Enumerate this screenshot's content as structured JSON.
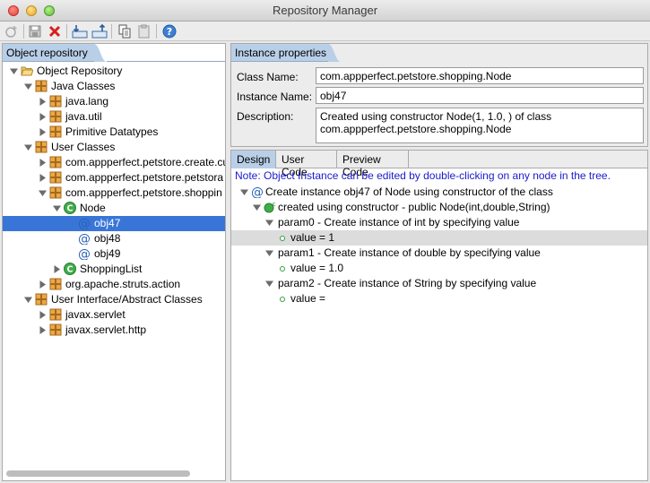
{
  "window": {
    "title": "Repository Manager"
  },
  "toolbar": {
    "icons": [
      "add-icon",
      "save-icon",
      "delete-icon",
      "import-icon",
      "export-icon",
      "copy-icon",
      "paste-icon",
      "help-icon"
    ]
  },
  "left": {
    "tab_label": "Object repository",
    "tree": [
      {
        "label": "Object Repository",
        "icon": "folder-open-icon",
        "expanded": true
      },
      {
        "label": "Java Classes",
        "icon": "package-icon",
        "expanded": true
      },
      {
        "label": "java.lang",
        "icon": "package-icon",
        "expanded": false
      },
      {
        "label": "java.util",
        "icon": "package-icon",
        "expanded": false
      },
      {
        "label": "Primitive Datatypes",
        "icon": "package-icon",
        "expanded": false
      },
      {
        "label": "User Classes",
        "icon": "package-icon",
        "expanded": true
      },
      {
        "label": "com.appperfect.petstore.create.cu",
        "icon": "package-icon",
        "expanded": false
      },
      {
        "label": "com.appperfect.petstore.petstora",
        "icon": "package-icon",
        "expanded": false
      },
      {
        "label": "com.appperfect.petstore.shoppin",
        "icon": "package-icon",
        "expanded": true
      },
      {
        "label": "Node",
        "icon": "class-icon",
        "expanded": true
      },
      {
        "label": "obj47",
        "icon": "instance-icon",
        "selected": true
      },
      {
        "label": "obj48",
        "icon": "instance-icon"
      },
      {
        "label": "obj49",
        "icon": "instance-icon"
      },
      {
        "label": "ShoppingList",
        "icon": "class-icon",
        "expanded": false
      },
      {
        "label": "org.apache.struts.action",
        "icon": "package-icon",
        "expanded": false
      },
      {
        "label": "User Interface/Abstract Classes",
        "icon": "package-icon",
        "expanded": true
      },
      {
        "label": "javax.servlet",
        "icon": "package-icon",
        "expanded": false
      },
      {
        "label": "javax.servlet.http",
        "icon": "package-icon",
        "expanded": false
      }
    ]
  },
  "instance": {
    "tab_label": "Instance properties",
    "class_name_label": "Class Name:",
    "class_name_value": "com.appperfect.petstore.shopping.Node",
    "instance_name_label": "Instance Name:",
    "instance_name_value": "obj47",
    "description_label": "Description:",
    "description_line1": "Created using  constructor Node(1, 1.0, ) of class",
    "description_line2": "com.appperfect.petstore.shopping.Node"
  },
  "design": {
    "tabs": [
      "Design",
      "User Code",
      "Preview Code"
    ],
    "note": "Note: Object Instance can be edited by double-clicking on any node in the tree.",
    "rows": [
      {
        "label": "Create instance obj47 of Node using constructor of the class",
        "kind": "instance"
      },
      {
        "label": "created using constructor - public Node(int,double,String)",
        "kind": "constructor"
      },
      {
        "label": "param0 - Create instance of int by specifying value",
        "kind": "param"
      },
      {
        "label": "value = 1",
        "kind": "value",
        "highlight": true
      },
      {
        "label": "param1 - Create instance of double by specifying value",
        "kind": "param"
      },
      {
        "label": "value = 1.0",
        "kind": "value"
      },
      {
        "label": "param2 - Create instance of String by specifying value",
        "kind": "param"
      },
      {
        "label": "value =",
        "kind": "value"
      }
    ]
  },
  "colors": {
    "selection": "#3875d7",
    "tab_active": "#b9cfe8",
    "note": "#1a1acc"
  }
}
